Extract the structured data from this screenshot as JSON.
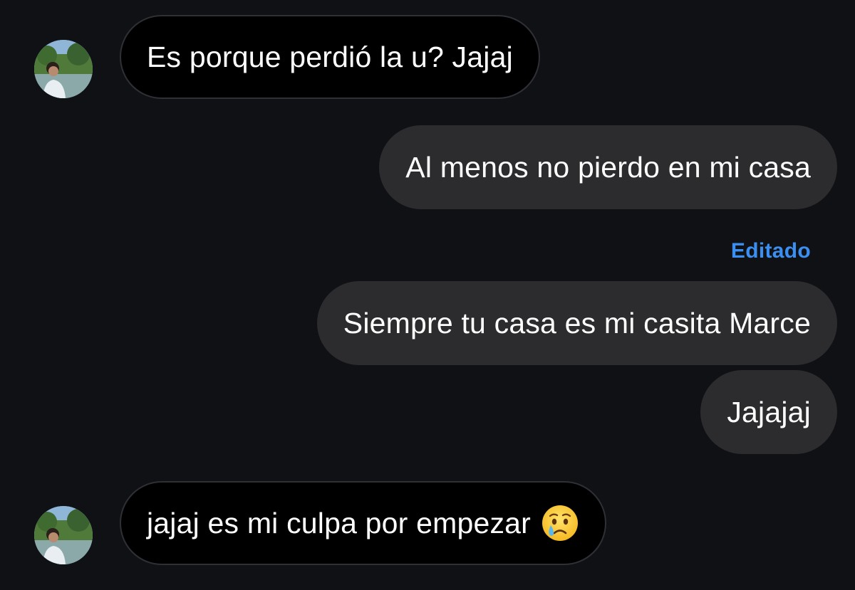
{
  "conversation": {
    "messages": [
      {
        "direction": "incoming",
        "text": "Es porque perdió la u? Jajaj"
      },
      {
        "direction": "outgoing",
        "text": "Al menos no pierdo en mi casa"
      },
      {
        "direction": "outgoing",
        "text": "Siempre tu casa es mi casita Marce",
        "edited_label": "Editado"
      },
      {
        "direction": "outgoing",
        "text": "Jajajaj"
      },
      {
        "direction": "incoming",
        "text": "jajaj es mi culpa por empezar",
        "emoji": "crying-face"
      }
    ]
  },
  "colors": {
    "background": "#0f1115",
    "incoming_bubble": "#000000",
    "outgoing_bubble": "#2c2c2e",
    "edited_label": "#3b8ff0"
  },
  "icons": {
    "avatar": "contact-avatar-photo",
    "emoji": "crying-face-emoji"
  }
}
